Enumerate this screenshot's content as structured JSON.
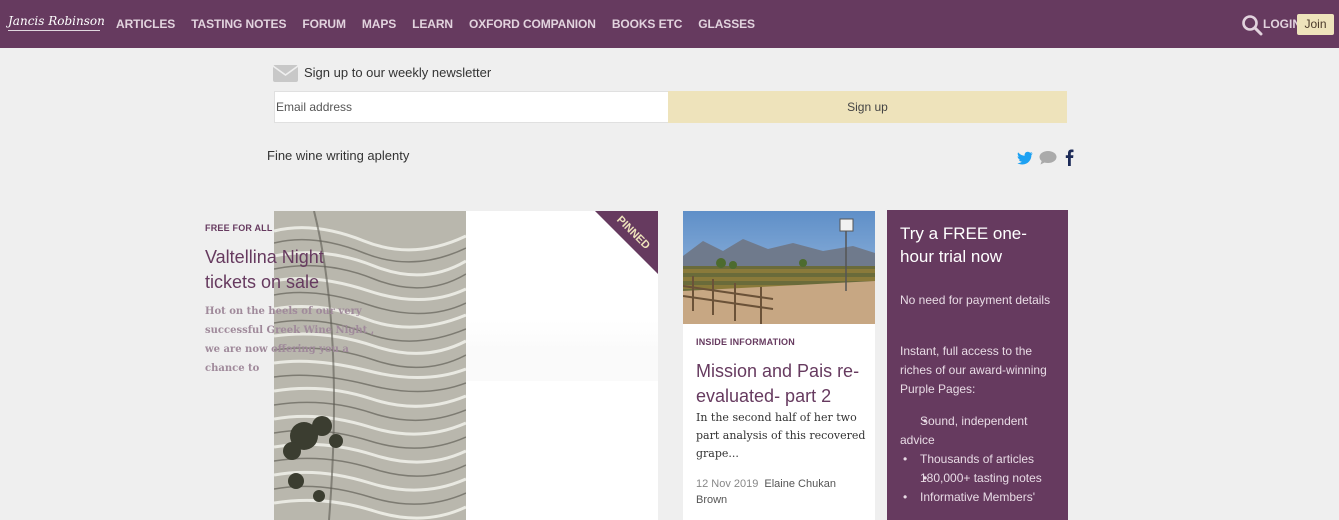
{
  "brand": {
    "logo_text": "Jancis Robinson"
  },
  "nav": {
    "items": [
      "ARTICLES",
      "TASTING NOTES",
      "FORUM",
      "MAPS",
      "LEARN",
      "OXFORD COMPANION",
      "BOOKS ETC",
      "GLASSES"
    ],
    "login": "LOGIN",
    "join": "Join"
  },
  "newsletter": {
    "title": "Sign up to our weekly newsletter",
    "email_placeholder": "Email address",
    "button": "Sign up"
  },
  "tagline": "Fine wine writing aplenty",
  "social": [
    "twitter-icon",
    "comment-icon",
    "facebook-icon"
  ],
  "cards": [
    {
      "badge": "FREE FOR ALL",
      "title": "Valtellina Night tickets on sale",
      "excerpt": "Hot on the heels of our very successful Greek Wine Night , we are now offering you a chance to",
      "ribbon": "PINNED"
    },
    {
      "badge": "INSIDE INFORMATION",
      "title": "Mission and Pais re-evaluated- part 2",
      "excerpt": "In the second half of her two part analysis of this recovered grape...",
      "date": "12 Nov 2019",
      "author": "Elaine Chukan Brown"
    }
  ],
  "trial": {
    "title": "Try a FREE one-hour trial now",
    "p1": "No need for payment details",
    "p2": "Instant, full access to the riches of our award-winning Purple Pages:",
    "bullets": [
      "Sound, independent advice",
      "Thousands of articles",
      "180,000+ tasting notes",
      "Informative Members'"
    ]
  },
  "colors": {
    "brand_purple": "#663a5f",
    "accent_cream": "#eee3bb",
    "background": "#efefef"
  }
}
